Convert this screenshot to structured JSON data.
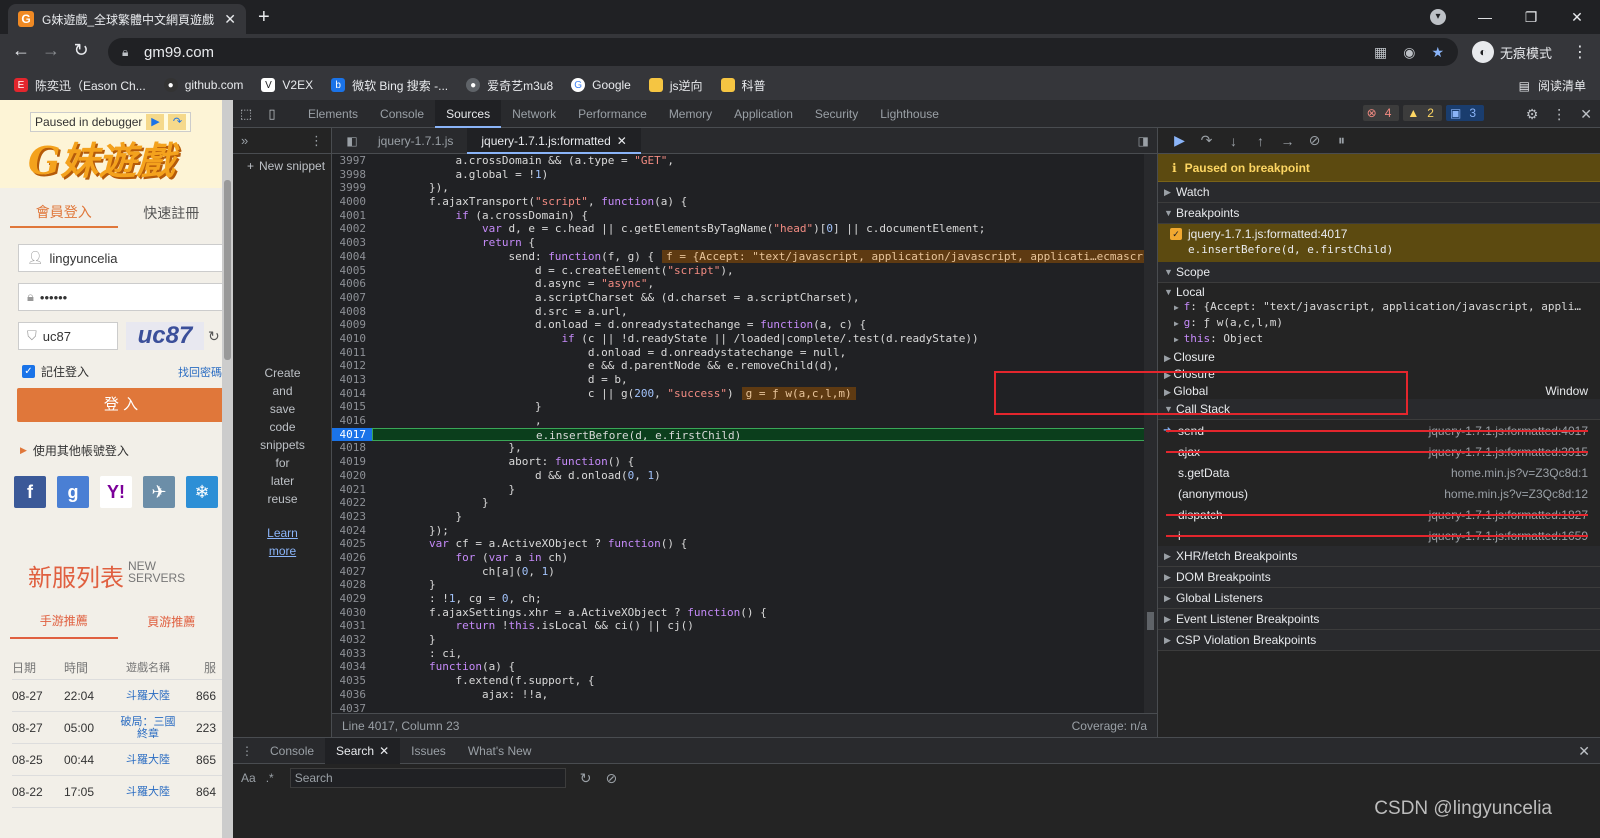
{
  "browser": {
    "tab_title": "G妹遊戲_全球繁體中文網頁遊戲",
    "tab_favicon": "G",
    "url": "gm99.com",
    "incognito_label": "无痕模式",
    "reading_list": "阅读清单",
    "bookmarks": [
      {
        "label": "陈奕迅（Eason Ch...",
        "color": "#e3262d",
        "icon": "E"
      },
      {
        "label": "github.com",
        "color": "#333333",
        "icon": "●"
      },
      {
        "label": "V2EX",
        "color": "#ffffff",
        "icon": "V"
      },
      {
        "label": "微软 Bing 搜索 -...",
        "color": "#1a73e8",
        "icon": "b"
      },
      {
        "label": "爱奇艺m3u8",
        "color": "#5f6368",
        "icon": "●"
      },
      {
        "label": "Google",
        "color": "#ffffff",
        "icon": "G"
      },
      {
        "label": "js逆向",
        "color": "#f5c542",
        "icon": ""
      },
      {
        "label": "科普",
        "color": "#f5c542",
        "icon": ""
      }
    ]
  },
  "webpage": {
    "paused_badge": "Paused in debugger",
    "logo": "G妹遊戲",
    "tab_login": "會員登入",
    "tab_register": "快速註冊",
    "username": "lingyuncelia",
    "password_mask": "••••••",
    "captcha_value": "uc87",
    "captcha_image_text": "uc87",
    "remember": "記住登入",
    "forgot": "找回密碼",
    "login_button": "登 入",
    "other_login": "使用其他帳號登入",
    "servers_title": "新服列表",
    "servers_sub_1": "NEW",
    "servers_sub_2": "SERVERS",
    "server_tab_mobile": "手游推薦",
    "server_tab_web": "頁游推薦",
    "table_head": {
      "date": "日期",
      "time": "時間",
      "game": "遊戲名稱",
      "server": "服"
    },
    "rows": [
      {
        "date": "08-27",
        "time": "22:04",
        "game": "斗羅大陸",
        "server": "866"
      },
      {
        "date": "08-27",
        "time": "05:00",
        "game": "破局：三國終章",
        "server": "223"
      },
      {
        "date": "08-25",
        "time": "00:44",
        "game": "斗羅大陸",
        "server": "865"
      },
      {
        "date": "08-22",
        "time": "17:05",
        "game": "斗羅大陸",
        "server": "864"
      }
    ]
  },
  "devtools": {
    "tabs": [
      "Elements",
      "Console",
      "Sources",
      "Network",
      "Performance",
      "Memory",
      "Application",
      "Security",
      "Lighthouse"
    ],
    "active_tab": "Sources",
    "badge_errors": "4",
    "badge_warnings": "2",
    "badge_info": "3",
    "new_snippet": "New snippet",
    "snippet_help": [
      "Create",
      "and",
      "save",
      "code",
      "snippets",
      "for",
      "later",
      "reuse"
    ],
    "learn_more": [
      "Learn",
      "more"
    ],
    "file_tabs": [
      "jquery-1.7.1.js",
      "jquery-1.7.1.js:formatted"
    ],
    "status_position": "Line 4017, Column 23",
    "status_coverage": "Coverage: n/a",
    "paused_on": "Paused on breakpoint",
    "sections": {
      "watch": "Watch",
      "breakpoints": "Breakpoints",
      "scope": "Scope",
      "local": "Local",
      "call_stack": "Call Stack",
      "xhr": "XHR/fetch Breakpoints",
      "dom": "DOM Breakpoints",
      "global_listeners": "Global Listeners",
      "event_listener": "Event Listener Breakpoints",
      "csp": "CSP Violation Breakpoints"
    },
    "breakpoint": {
      "location": "jquery-1.7.1.js:formatted:4017",
      "code": "e.insertBefore(d, e.firstChild)"
    },
    "scope_local": [
      {
        "key": "f",
        "value": ": {Accept: \"text/javascript, application/javascript, appli…"
      },
      {
        "key": "g",
        "value": ": ƒ w(a,c,l,m)"
      },
      {
        "key": "this",
        "value": ": Object"
      }
    ],
    "scope_other": [
      {
        "label": "Closure",
        "value": ""
      },
      {
        "label": "Closure",
        "value": ""
      },
      {
        "label": "Global",
        "value": "Window"
      }
    ],
    "call_stack": [
      {
        "name": "send",
        "loc": "jquery-1.7.1.js:formatted:4017",
        "struck": true,
        "current": true
      },
      {
        "name": "ajax",
        "loc": "jquery-1.7.1.js:formatted:3915",
        "struck": true,
        "current": false
      },
      {
        "name": "s.getData",
        "loc": "home.min.js?v=Z3Qc8d:1",
        "struck": false,
        "current": false
      },
      {
        "name": "(anonymous)",
        "loc": "home.min.js?v=Z3Qc8d:12",
        "struck": false,
        "current": false
      },
      {
        "name": "dispatch",
        "loc": "jquery-1.7.1.js:formatted:1827",
        "struck": true,
        "current": false
      },
      {
        "name": "i",
        "loc": "jquery-1.7.1.js:formatted:1659",
        "struck": true,
        "current": false
      }
    ],
    "drawer_tabs": [
      "Console",
      "Search",
      "Issues",
      "What's New"
    ],
    "drawer_active": "Search",
    "search_aa": "Aa",
    "search_regex": ".*",
    "search_placeholder": "Search"
  },
  "code_lines": [
    {
      "n": "3997",
      "t": "            a.crossDomain && (a.type = \"GET\","
    },
    {
      "n": "3998",
      "t": "            a.global = !1)"
    },
    {
      "n": "3999",
      "t": "        }),"
    },
    {
      "n": "4000",
      "t": "        f.ajaxTransport(\"script\", function(a) {"
    },
    {
      "n": "4001",
      "t": "            if (a.crossDomain) {"
    },
    {
      "n": "4002",
      "t": "                var d, e = c.head || c.getElementsByTagName(\"head\")[0] || c.documentElement;"
    },
    {
      "n": "4003",
      "t": "                return {"
    },
    {
      "n": "4004",
      "t": "                    send: function(f, g) {",
      "v": "f = {Accept: \"text/javascript, application/javascript, applicati…ecmascript, a"
    },
    {
      "n": "4005",
      "t": "                        d = c.createElement(\"script\"),"
    },
    {
      "n": "4006",
      "t": "                        d.async = \"async\","
    },
    {
      "n": "4007",
      "t": "                        a.scriptCharset && (d.charset = a.scriptCharset),"
    },
    {
      "n": "4008",
      "t": "                        d.src = a.url,"
    },
    {
      "n": "4009",
      "t": "                        d.onload = d.onreadystatechange = function(a, c) {"
    },
    {
      "n": "4010",
      "t": "                            if (c || !d.readyState || /loaded|complete/.test(d.readyState))"
    },
    {
      "n": "4011",
      "t": "                                d.onload = d.onreadystatechange = null,"
    },
    {
      "n": "4012",
      "t": "                                e && d.parentNode && e.removeChild(d),"
    },
    {
      "n": "4013",
      "t": "                                d = b,"
    },
    {
      "n": "4014",
      "t": "                                c || g(200, \"success\")",
      "v": "g = ƒ w(a,c,l,m)"
    },
    {
      "n": "4015",
      "t": "                        }"
    },
    {
      "n": "4016",
      "t": "                        ,"
    },
    {
      "n": "4017",
      "t": "                        e.insertBefore(d, e.firstChild)",
      "bp": true
    },
    {
      "n": "4018",
      "t": "                    },"
    },
    {
      "n": "4019",
      "t": "                    abort: function() {"
    },
    {
      "n": "4020",
      "t": "                        d && d.onload(0, 1)"
    },
    {
      "n": "4021",
      "t": "                    }"
    },
    {
      "n": "4022",
      "t": "                }"
    },
    {
      "n": "4023",
      "t": "            }"
    },
    {
      "n": "4024",
      "t": "        });"
    },
    {
      "n": "4025",
      "t": "        var cf = a.ActiveXObject ? function() {"
    },
    {
      "n": "4026",
      "t": "            for (var a in ch)"
    },
    {
      "n": "4027",
      "t": "                ch[a](0, 1)"
    },
    {
      "n": "4028",
      "t": "        }"
    },
    {
      "n": "4029",
      "t": "        : !1, cg = 0, ch;"
    },
    {
      "n": "4030",
      "t": "        f.ajaxSettings.xhr = a.ActiveXObject ? function() {"
    },
    {
      "n": "4031",
      "t": "            return !this.isLocal && ci() || cj()"
    },
    {
      "n": "4032",
      "t": "        }"
    },
    {
      "n": "4033",
      "t": "        : ci,"
    },
    {
      "n": "4034",
      "t": "        function(a) {"
    },
    {
      "n": "4035",
      "t": "            f.extend(f.support, {"
    },
    {
      "n": "4036",
      "t": "                ajax: !!a,"
    },
    {
      "n": "4037",
      "t": ""
    }
  ],
  "watermark": "CSDN @lingyuncelia"
}
